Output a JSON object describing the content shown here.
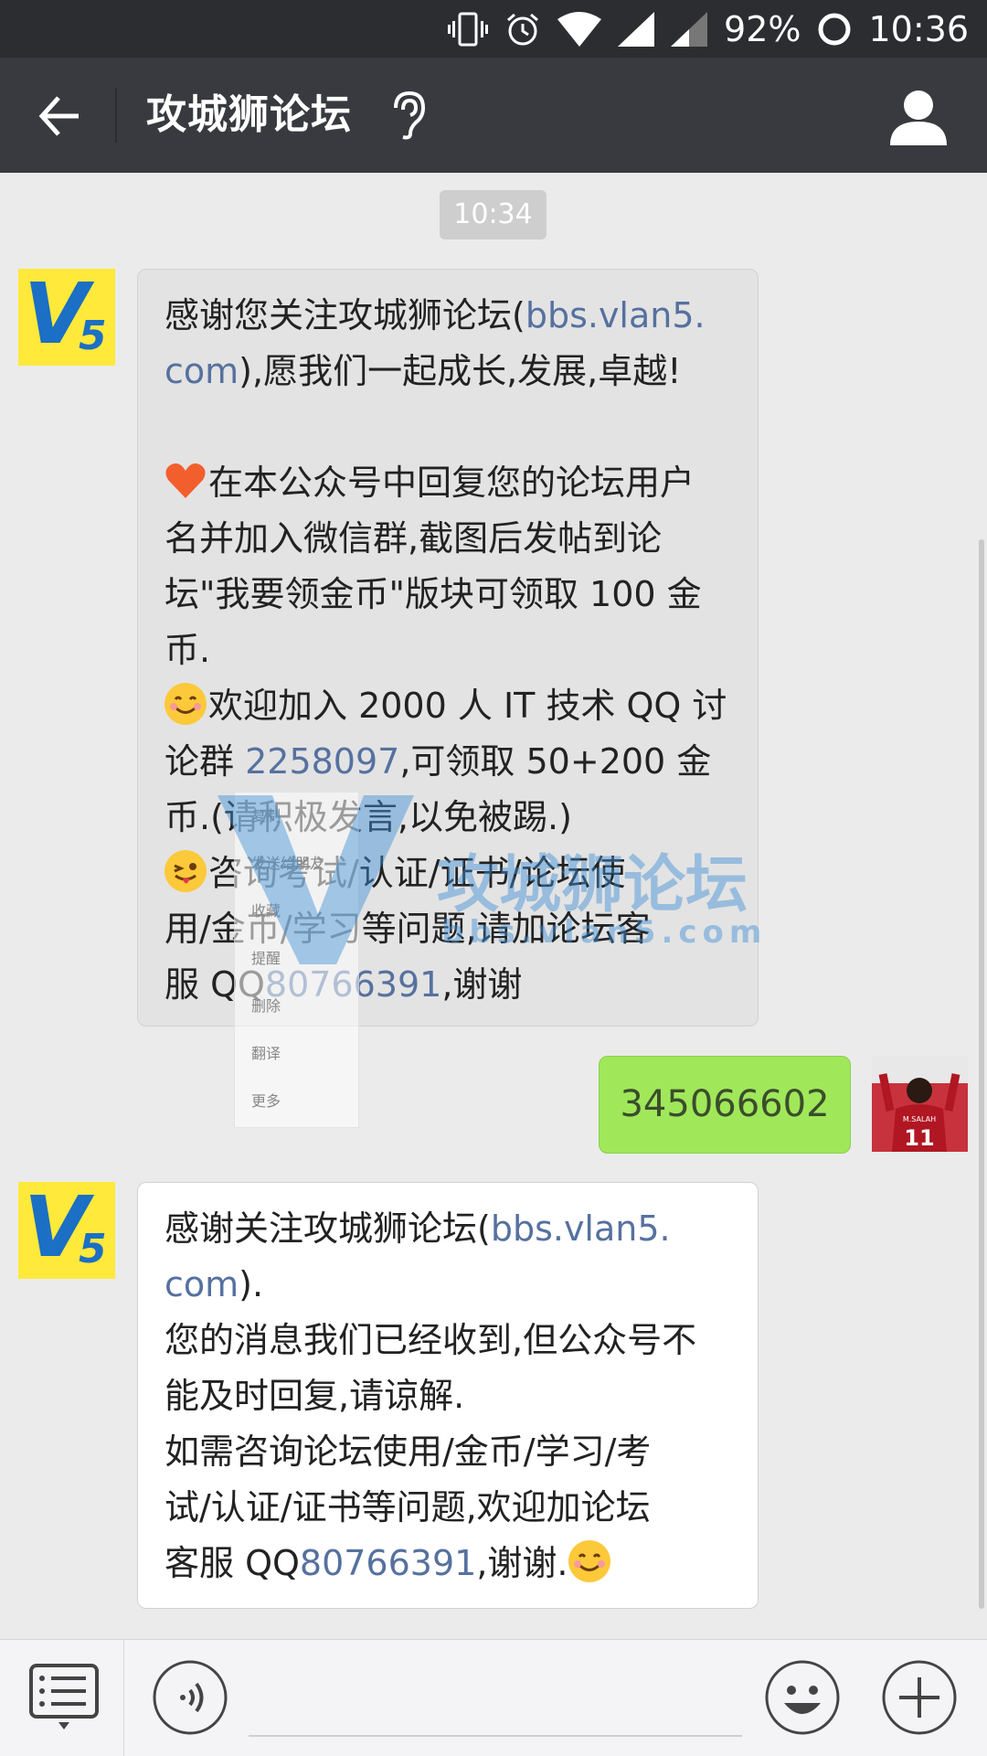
{
  "status_bar": {
    "battery": "92%",
    "time": "10:36"
  },
  "header": {
    "title": "攻城狮论坛"
  },
  "chat": {
    "timestamp": "10:34",
    "messages": [
      {
        "lines": [
          {
            "pre": "感谢您关注攻城狮论坛(",
            "link": "bbs.vlan5.",
            "post": ""
          },
          {
            "pre": "",
            "link": "com",
            "post": "),愿我们一起成长,发展,卓越!"
          },
          {
            "pre": "",
            "link": "",
            "post": ""
          },
          {
            "pre": "在本公众号中回复您的论坛用户",
            "link": "",
            "post": ""
          },
          {
            "pre": "名并加入微信群,截图后发帖到论",
            "link": "",
            "post": ""
          },
          {
            "pre": "坛\"我要领金币\"版块可领取 100 金",
            "link": "",
            "post": ""
          },
          {
            "pre": "币.",
            "link": "",
            "post": ""
          },
          {
            "pre": "欢迎加入 2000 人 IT 技术 QQ 讨",
            "link": "",
            "post": ""
          },
          {
            "pre": "论群 ",
            "link": "2258097",
            "post": ",可领取 50+200 金"
          },
          {
            "pre": "币.(请积极发言,以免被踢.)",
            "link": "",
            "post": ""
          },
          {
            "pre": "咨询考试/认证/证书/论坛使",
            "link": "",
            "post": ""
          },
          {
            "pre": "用/金币/学习等问题,请加论坛客",
            "link": "",
            "post": ""
          },
          {
            "pre": "服 QQ",
            "link": "80766391",
            "post": ",谢谢"
          }
        ]
      },
      {
        "text": "345066602"
      },
      {
        "lines": [
          {
            "pre": "感谢关注攻城狮论坛(",
            "link": "bbs.vlan5.",
            "post": ""
          },
          {
            "pre": "",
            "link": "com",
            "post": ")."
          },
          {
            "pre": "您的消息我们已经收到,但公众号不",
            "link": "",
            "post": ""
          },
          {
            "pre": "能及时回复,请谅解.",
            "link": "",
            "post": ""
          },
          {
            "pre": "如需咨询论坛使用/金币/学习/考",
            "link": "",
            "post": ""
          },
          {
            "pre": "试/认证/证书等问题,欢迎加论坛",
            "link": "",
            "post": ""
          },
          {
            "pre": "客服 QQ",
            "link": "80766391",
            "post": ",谢谢."
          }
        ]
      }
    ]
  },
  "context_menu": {
    "items": [
      "复制",
      "发送给朋友",
      "收藏",
      "提醒",
      "删除",
      "翻译",
      "更多"
    ]
  },
  "watermark": {
    "brand": "攻城狮论坛",
    "url": "bbs.vlan5.com"
  },
  "avatar_text": {
    "v": "V",
    "five": "5",
    "jersey_number": "11",
    "jersey_name": "M.SALAH"
  },
  "colors": {
    "link": "#56719f",
    "sent_bubble": "#a0e75a",
    "header_bg": "#393a3f"
  }
}
